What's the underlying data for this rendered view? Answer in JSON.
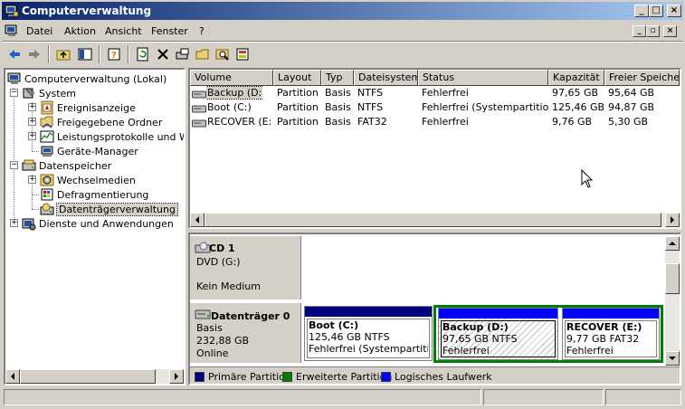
{
  "window": {
    "title": "Computerverwaltung"
  },
  "menu": {
    "items": [
      "Datei",
      "Aktion",
      "Ansicht",
      "Fenster",
      "?"
    ]
  },
  "tree": {
    "root": "Computerverwaltung (Lokal)",
    "system": "System",
    "ereignis": "Ereignisanzeige",
    "ordner": "Freigegebene Ordner",
    "leistung": "Leistungsprotokolle und Warnungen",
    "geraete": "Geräte-Manager",
    "datenspeicher": "Datenspeicher",
    "wechsel": "Wechselmedien",
    "defrag": "Defragmentierung",
    "dtv": "Datenträgerverwaltung",
    "dienste": "Dienste und Anwendungen"
  },
  "volumes": {
    "columns": [
      "Volume",
      "Layout",
      "Typ",
      "Dateisystem",
      "Status",
      "Kapazität",
      "Freier Speicher"
    ],
    "rows": [
      {
        "volume": "Backup (D:)",
        "layout": "Partition",
        "typ": "Basis",
        "fs": "NTFS",
        "status": "Fehlerfrei",
        "kap": "97,65 GB",
        "frei": "95,64 GB"
      },
      {
        "volume": "Boot (C:)",
        "layout": "Partition",
        "typ": "Basis",
        "fs": "NTFS",
        "status": "Fehlerfrei (Systempartition)",
        "kap": "125,46 GB",
        "frei": "94,87 GB"
      },
      {
        "volume": "RECOVER (E:)",
        "layout": "Partition",
        "typ": "Basis",
        "fs": "FAT32",
        "status": "Fehlerfrei",
        "kap": "9,76 GB",
        "frei": "5,30 GB"
      }
    ]
  },
  "cd": {
    "name": "CD 1",
    "line1": "DVD (G:)",
    "line2": "Kein Medium"
  },
  "disk0": {
    "name": "Datenträger 0",
    "type": "Basis",
    "size": "232,88 GB",
    "state": "Online",
    "parts": [
      {
        "title": "Boot  (C:)",
        "line1": "125,46 GB NTFS",
        "line2": "Fehlerfrei (Systempartition"
      },
      {
        "title": "Backup  (D:)",
        "line1": "97,65 GB NTFS",
        "line2": "Fehlerfrei"
      },
      {
        "title": "RECOVER  (E:)",
        "line1": "9,77 GB FAT32",
        "line2": "Fehlerfrei"
      }
    ]
  },
  "legend": {
    "primary": "Primäre Partition",
    "extended": "Erweiterte Partition",
    "logical": "Logisches Laufwerk"
  },
  "colors": {
    "primary": "#00007e",
    "extended": "#008000",
    "logical": "#0000ff",
    "titlebar": "#0a246a"
  }
}
